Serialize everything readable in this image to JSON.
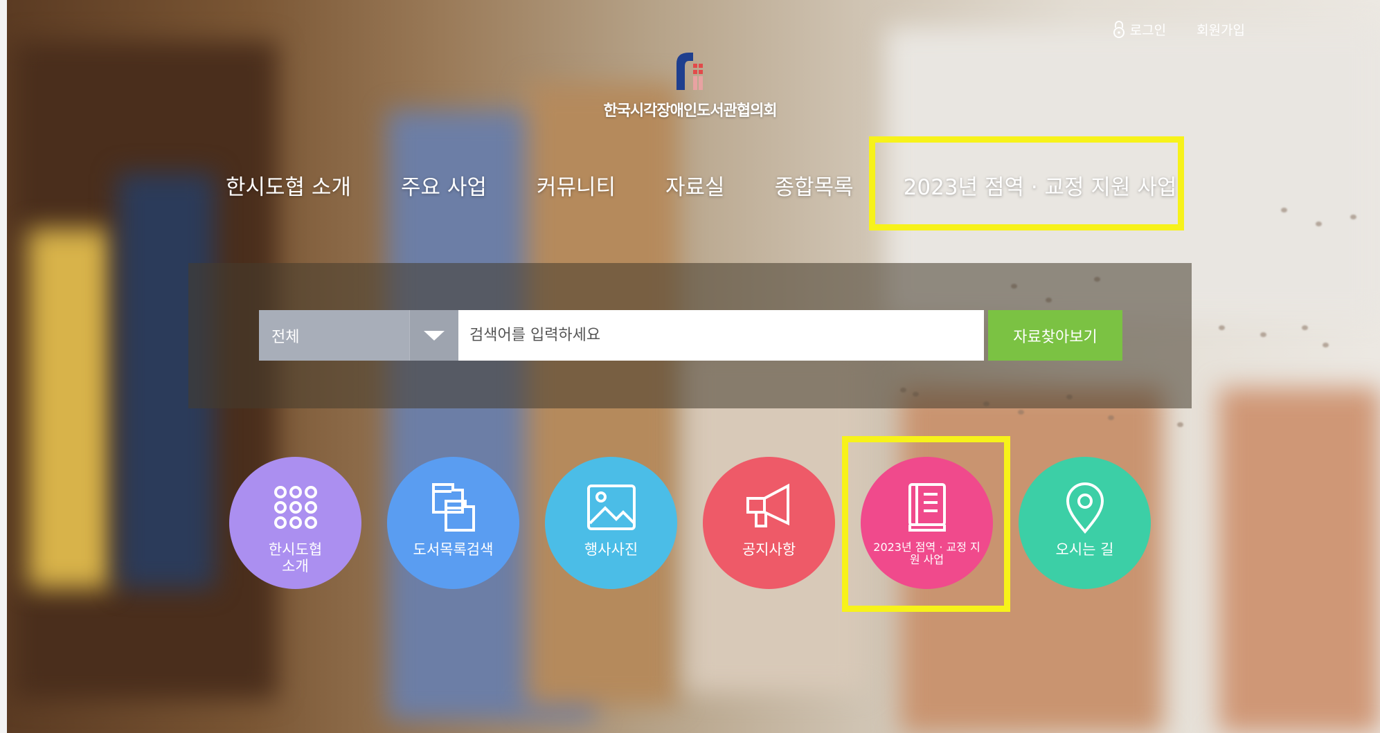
{
  "header": {
    "login_label": "로그인",
    "join_label": "회원가입",
    "org_name": "한국시각장애인도서관협의회"
  },
  "nav": {
    "items": [
      {
        "label": "한시도협 소개"
      },
      {
        "label": "주요 사업"
      },
      {
        "label": "커뮤니티"
      },
      {
        "label": "자료실"
      },
      {
        "label": "종합목록"
      },
      {
        "label": "2023년 점역 · 교정 지원 사업"
      }
    ]
  },
  "search": {
    "scope_selected": "전체",
    "placeholder": "검색어를 입력하세요",
    "button_label": "자료찾아보기"
  },
  "quick_links": [
    {
      "label": "한시도협 소개",
      "icon": "grid-dots-icon",
      "color": "#ab8ff0"
    },
    {
      "label": "도서목록검색",
      "icon": "documents-icon",
      "color": "#5a9df1"
    },
    {
      "label": "행사사진",
      "icon": "image-icon",
      "color": "#4bbde7"
    },
    {
      "label": "공지사항",
      "icon": "megaphone-icon",
      "color": "#ee5a68"
    },
    {
      "label": "2023년 점역 · 교정 지원 사업",
      "icon": "book-icon",
      "color": "#f04a8c"
    },
    {
      "label": "오시는 길",
      "icon": "location-pin-icon",
      "color": "#3ccfa6"
    }
  ],
  "colors": {
    "highlight": "#f7f21a",
    "search_button": "#7bc243",
    "select_bg": "#a8aeb9"
  }
}
